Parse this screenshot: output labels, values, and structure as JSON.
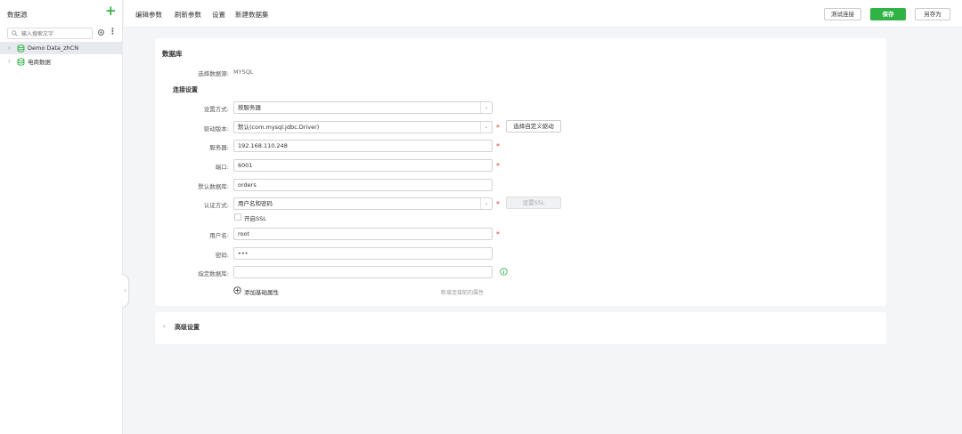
{
  "sidebar": {
    "title": "数据源",
    "search_placeholder": "输入搜索文字",
    "items": [
      {
        "label": "Demo Data_zhCN",
        "active": true
      },
      {
        "label": "电商数据",
        "active": false
      }
    ]
  },
  "toolbar": {
    "menus": [
      "编辑参数",
      "刷新参数",
      "设置",
      "新建数据集"
    ],
    "test_connection": "测试连接",
    "save": "保存",
    "save_as": "另存为"
  },
  "colors": {
    "accent": "#2fb344",
    "required": "#e53935"
  },
  "form": {
    "card_title": "数据库",
    "datasource_label": "选择数据源:",
    "datasource_value": "MYSQL",
    "conn_section": "连接设置",
    "method_label": "设置方式:",
    "method_value": "按服务器",
    "driver_label": "驱动版本:",
    "driver_value": "默认(com.mysql.jdbc.Driver)",
    "custom_driver_btn": "选择自定义驱动",
    "server_label": "服务器:",
    "server_value": "192.168.110.248",
    "port_label": "端口:",
    "port_value": "6001",
    "default_db_label": "默认数据库:",
    "default_db_value": "orders",
    "auth_label": "认证方式:",
    "auth_value": "用户名和密码",
    "ssl_btn": "设置SSL",
    "enable_ssl": "开启SSL",
    "user_label": "用户名:",
    "user_value": "root",
    "password_label": "密码:",
    "password_value": "•••",
    "specify_db_label": "指定数据库:",
    "specify_db_value": "",
    "add_attr": "添加基础属性",
    "add_attr_hint": "新增连接前的属性"
  },
  "advanced": {
    "title": "高级设置"
  }
}
